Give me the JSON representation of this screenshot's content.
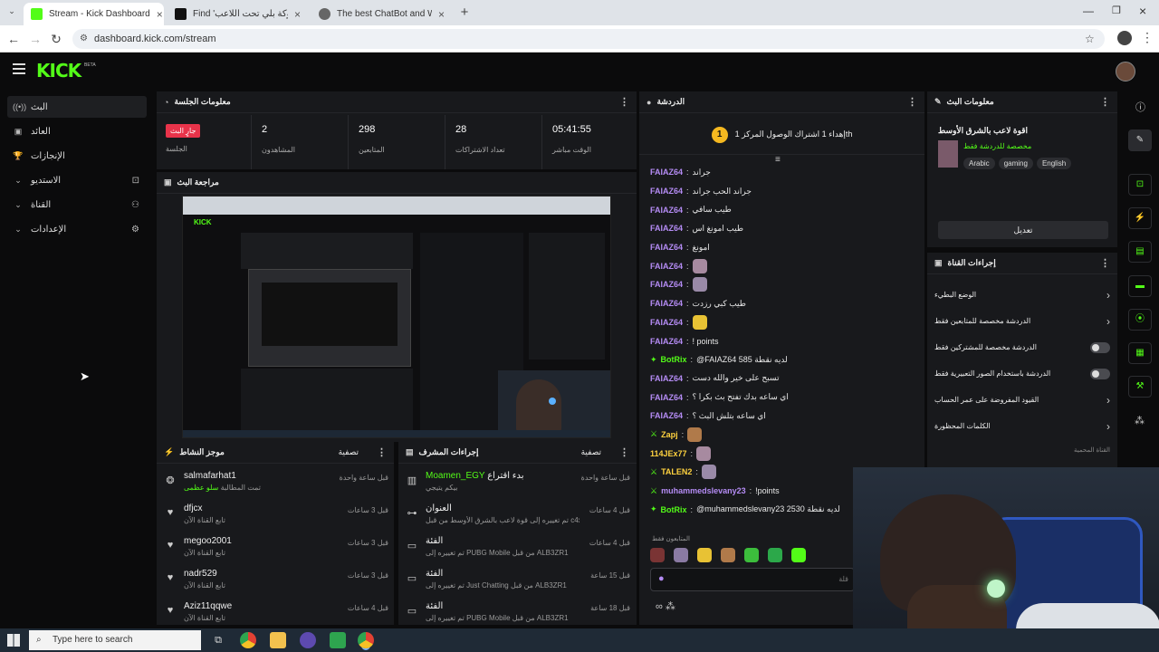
{
  "browser": {
    "tabs": [
      {
        "title": "Stream - Kick Dashboard",
        "favicon_color": "#53fc18",
        "active": true
      },
      {
        "title": "Find 'كسر البلوكة بلي تحت اللاعب' ...",
        "favicon_color": "#111111",
        "active": false
      },
      {
        "title": "The best ChatBot and Widgets f...",
        "favicon_color": "#666666",
        "active": false
      }
    ],
    "url": "dashboard.kick.com/stream"
  },
  "kick": {
    "logo": "KICK",
    "beta": "BETA"
  },
  "sidebar": {
    "items": [
      {
        "label": "البث",
        "icon": "broadcast-icon"
      },
      {
        "label": "العائد",
        "icon": "revenue-icon"
      },
      {
        "label": "الإنجازات",
        "icon": "trophy-icon"
      },
      {
        "label": "الاستديو",
        "icon": "studio-icon"
      },
      {
        "label": "القناة",
        "icon": "channel-icon"
      },
      {
        "label": "الإعدادات",
        "icon": "gear-icon"
      }
    ]
  },
  "session": {
    "title": "معلومات الجلسة",
    "live_badge": "جارٍ البث",
    "session_label": "الجلسة",
    "viewers_value": "2",
    "viewers_label": "المشاهدون",
    "followers_value": "298",
    "followers_label": "المتابعين",
    "subs_value": "28",
    "subs_label": "تعداد الاشتراكات",
    "uptime_value": "05:41:55",
    "uptime_label": "الوقت مباشر"
  },
  "preview": {
    "title": "مراجعة البث"
  },
  "activity": {
    "title": "موجز النشاط",
    "filter": "تصفية",
    "rows": [
      {
        "name": "salmafarhat1",
        "sub_a": "تمت المطالبة",
        "sub_b": "سلو عظمى",
        "time": "قبل ساعة واحدة"
      },
      {
        "name": "dfjcx",
        "sub_a": "تابع القناة الآن",
        "sub_b": "",
        "time": "قبل 3 ساعات"
      },
      {
        "name": "megoo2001",
        "sub_a": "تابع القناة الآن",
        "sub_b": "",
        "time": "قبل 3 ساعات"
      },
      {
        "name": "nadr529",
        "sub_a": "تابع القناة الآن",
        "sub_b": "",
        "time": "قبل 3 ساعات"
      },
      {
        "name": "Aziz11qqwe",
        "sub_a": "تابع القناة الآن",
        "sub_b": "",
        "time": "قبل 4 ساعات"
      }
    ]
  },
  "modactions": {
    "title": "إجراءات المشرف",
    "filter": "تصفية",
    "rows": [
      {
        "name_a": "Moamen_EGY",
        "name_b": "بدء اقتراع",
        "sub": "بيكم يتيجي",
        "time": "قبل ساعة واحدة"
      },
      {
        "name_a": "العنوان",
        "name_b": "",
        "sub": "تم تغييره إلى قوة لاعب بالشرق الأوسط من قبل c4x_77",
        "time": "قبل 4 ساعات"
      },
      {
        "name_a": "الفئة",
        "name_b": "",
        "sub": "تم تغييره إلى PUBG Mobile من قبل ALB3ZR1",
        "time": "قبل 4 ساعات"
      },
      {
        "name_a": "الفئة",
        "name_b": "",
        "sub": "تم تغييره إلى Just Chatting من قبل ALB3ZR1",
        "time": "قبل 15 ساعة"
      },
      {
        "name_a": "الفئة",
        "name_b": "",
        "sub": "تم تغييره إلى PUBG Mobile من قبل ALB3ZR1",
        "time": "قبل 18 ساعة"
      }
    ]
  },
  "chat": {
    "title": "الدردشة",
    "goal_count": "1",
    "goal_text": "إهداء 1 اشتراك الوصول المركز 1th",
    "messages": [
      {
        "user": "FAIAZ64",
        "text": "جراند",
        "badges": "",
        "emote": false,
        "color": "purple"
      },
      {
        "user": "FAIAZ64",
        "text": "جراند الحب جراند",
        "badges": "",
        "emote": false,
        "color": "purple"
      },
      {
        "user": "FAIAZ64",
        "text": "طيب سافي",
        "badges": "",
        "emote": false,
        "color": "purple"
      },
      {
        "user": "FAIAZ64",
        "text": "طيب امونغ اس",
        "badges": "",
        "emote": false,
        "color": "purple"
      },
      {
        "user": "FAIAZ64",
        "text": "امونغ",
        "badges": "",
        "emote": false,
        "color": "purple"
      },
      {
        "user": "FAIAZ64",
        "text": "",
        "badges": "",
        "emote": true,
        "color": "purple"
      },
      {
        "user": "FAIAZ64",
        "text": "",
        "badges": "",
        "emote": true,
        "color": "purple"
      },
      {
        "user": "FAIAZ64",
        "text": "طيب كبي رزدت",
        "badges": "",
        "emote": false,
        "color": "purple"
      },
      {
        "user": "FAIAZ64",
        "text": "",
        "badges": "",
        "emote": true,
        "color": "purple"
      },
      {
        "user": "FAIAZ64",
        "text": "! points",
        "badges": "",
        "emote": false,
        "color": "purple"
      },
      {
        "user": "BotRix",
        "text": "@FAIAZ64 585 لديه نقطة",
        "badges": "bot",
        "emote": false,
        "color": "green"
      },
      {
        "user": "FAIAZ64",
        "text": "تسبح على خير والله دست",
        "badges": "",
        "emote": false,
        "color": "purple"
      },
      {
        "user": "FAIAZ64",
        "text": "اي ساعه بدك تفتح بث بكرا ؟",
        "badges": "",
        "emote": false,
        "color": "purple"
      },
      {
        "user": "FAIAZ64",
        "text": "اي ساعه بتلش البث ؟",
        "badges": "",
        "emote": false,
        "color": "purple"
      },
      {
        "user": "Zapj",
        "text": "",
        "badges": "mod",
        "emote": true,
        "color": "orange"
      },
      {
        "user": "114JEx77",
        "text": "",
        "badges": "",
        "emote": true,
        "color": "orange"
      },
      {
        "user": "TALEN2",
        "text": "",
        "badges": "mod",
        "emote": true,
        "color": "orange"
      },
      {
        "user": "muhammedslevany23",
        "text": "!points",
        "badges": "mod",
        "emote": false,
        "color": "purple"
      },
      {
        "user": "BotRix",
        "text": "@muhammedslevany23 2530 لديه نقطة",
        "badges": "bot",
        "emote": false,
        "color": "green"
      }
    ],
    "followers_only": "المتابعون فقط",
    "input_placeholder": "قلة"
  },
  "streaminfo": {
    "title": "معلومات البث",
    "stream_title": "اقوة لاعب بالشرق الأوسط",
    "chat_mode": "مخصصة للدردشة فقط",
    "tags": [
      "Arabic",
      "gaming",
      "English"
    ],
    "edit_label": "تعديل"
  },
  "channelactions": {
    "title": "إجراءات القناة",
    "rows": [
      {
        "label": "الوضع البطيء",
        "control": "chevron"
      },
      {
        "label": "الدردشة مخصصة للمتابعين فقط",
        "control": "chevron"
      },
      {
        "label": "الدردشة مخصصة للمشتركين فقط",
        "control": "toggle"
      },
      {
        "label": "الدردشة باستخدام الصور التعبيرية فقط",
        "control": "toggle"
      },
      {
        "label": "القيود المفروضة على عمر الحساب",
        "control": "chevron"
      },
      {
        "label": "الكلمات المحظورة",
        "control": "chevron"
      }
    ],
    "footer": "القناة المحمية"
  },
  "taskbar": {
    "search_placeholder": "Type here to search"
  }
}
